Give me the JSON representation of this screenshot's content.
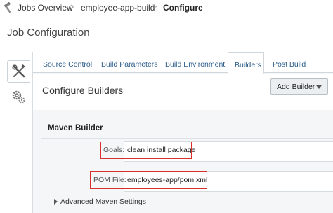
{
  "breadcrumb": {
    "items": [
      "Jobs Overview",
      "employee-app-build",
      "Configure"
    ],
    "separator": ">"
  },
  "page_title": "Job Configuration",
  "tabs": [
    {
      "label": "Source Control",
      "active": false
    },
    {
      "label": "Build Parameters",
      "active": false
    },
    {
      "label": "Build Environment",
      "active": false
    },
    {
      "label": "Builders",
      "active": true
    },
    {
      "label": "Post Build",
      "active": false
    }
  ],
  "content_title": "Configure Builders",
  "add_builder_label": "Add Builder",
  "maven": {
    "section_title": "Maven Builder",
    "goals_label": "Goals:",
    "goals_value": "clean install package",
    "pom_label": "POM File:",
    "pom_value": "employees-app/pom.xml",
    "advanced_label": "Advanced Maven Settings"
  },
  "colors": {
    "link": "#2c5c8a",
    "highlight": "#d9302b",
    "panel_bg": "#f4f6f8"
  },
  "icons": [
    "hammer-icon",
    "chevron-right-icon",
    "wrench-screwdriver-icon",
    "gears-icon",
    "caret-down-icon",
    "caret-right-icon"
  ]
}
